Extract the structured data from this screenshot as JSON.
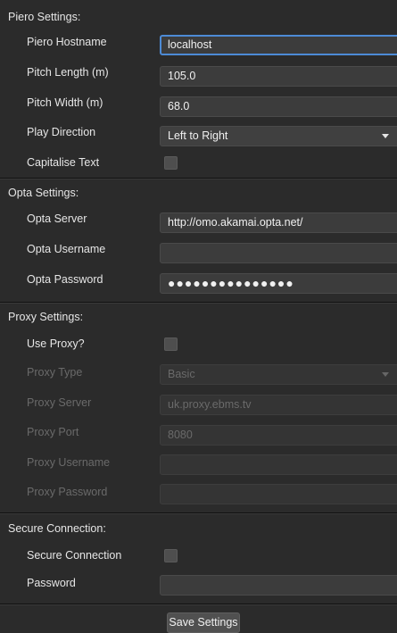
{
  "piero": {
    "title": "Piero Settings:",
    "hostname_label": "Piero Hostname",
    "hostname_value": "localhost",
    "pitch_length_label": "Pitch Length (m)",
    "pitch_length_value": "105.0",
    "pitch_width_label": "Pitch Width (m)",
    "pitch_width_value": "68.0",
    "play_direction_label": "Play Direction",
    "play_direction_value": "Left to Right",
    "capitalise_label": "Capitalise Text",
    "capitalise_checked": false
  },
  "opta": {
    "title": "Opta Settings:",
    "server_label": "Opta Server",
    "server_value": "http://omo.akamai.opta.net/",
    "username_label": "Opta Username",
    "username_value": "",
    "password_label": "Opta Password",
    "password_masked": "●●●●●●●●●●●●●●●"
  },
  "proxy": {
    "title": "Proxy Settings:",
    "use_proxy_label": "Use Proxy?",
    "use_proxy_checked": false,
    "type_label": "Proxy Type",
    "type_value": "Basic",
    "server_label": "Proxy Server",
    "server_value": "uk.proxy.ebms.tv",
    "port_label": "Proxy Port",
    "port_value": "8080",
    "username_label": "Proxy Username",
    "username_value": "",
    "password_label": "Proxy Password",
    "password_value": ""
  },
  "secure": {
    "title": "Secure Connection:",
    "secure_label": "Secure Connection",
    "secure_checked": false,
    "password_label": "Password",
    "password_value": ""
  },
  "actions": {
    "save_label": "Save Settings"
  },
  "colors": {
    "background": "#2b2b2b",
    "focus_border": "#4d8bd6",
    "disabled_text": "#6a6a6a"
  }
}
